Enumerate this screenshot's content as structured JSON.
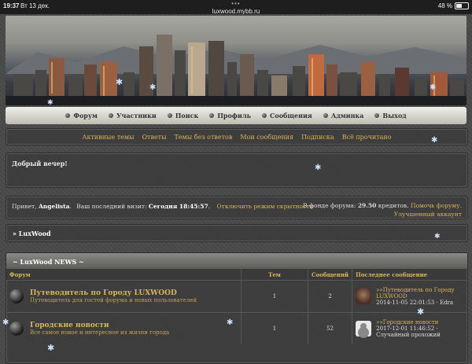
{
  "status": {
    "time": "19:37",
    "date": "Вт 13 дек.",
    "url": "luxwood.mybb.ru",
    "dots": "•••",
    "battery": "48 %",
    "battery_level": 0.48
  },
  "nav": {
    "items": [
      "Форум",
      "Участники",
      "Поиск",
      "Профиль",
      "Сообщения",
      "Админка",
      "Выход"
    ]
  },
  "links": [
    "Активные темы",
    "Ответы",
    "Темы без ответов",
    "Мои сообщения",
    "Подписка",
    "Всё прочитано"
  ],
  "welcome": {
    "title": "Добрый вечер!"
  },
  "info": {
    "greeting": "Привет,",
    "user": "Angelista",
    "last_visit_label": "Ваш последний визит:",
    "last_visit_value": "Сегодня 18:45:57",
    "hide_link": "Отключить режим скрытности",
    "fund_label": "В фонде форума:",
    "fund_value": "29.50",
    "fund_unit": "кредитов.",
    "help_link": "Помочь форуму.",
    "account_link": "Улучшенный аккаунт"
  },
  "crumb": "» LuxWood",
  "category": {
    "title": "~ LuxWood NEWS ~",
    "columns": [
      "Форум",
      "Тем",
      "Сообщений",
      "Последнее сообщение"
    ],
    "rows": [
      {
        "name": "Путеводитель по Городу LUXWOOD",
        "desc": "Путеводитель для гостей форума и новых пользователей",
        "topics": "1",
        "posts": "2",
        "last_title": "»»Путеводитель по Городу LUXWOOD",
        "last_meta": "2014-11-05 22:01:53 - Edra"
      },
      {
        "name": "Городские новости",
        "desc": "Все самое новое и интересное из жизни города",
        "topics": "1",
        "posts": "52",
        "last_title": "»»Городские новости",
        "last_meta": "2017-12-01 11:46:52 - Случайный прохожий"
      }
    ]
  }
}
